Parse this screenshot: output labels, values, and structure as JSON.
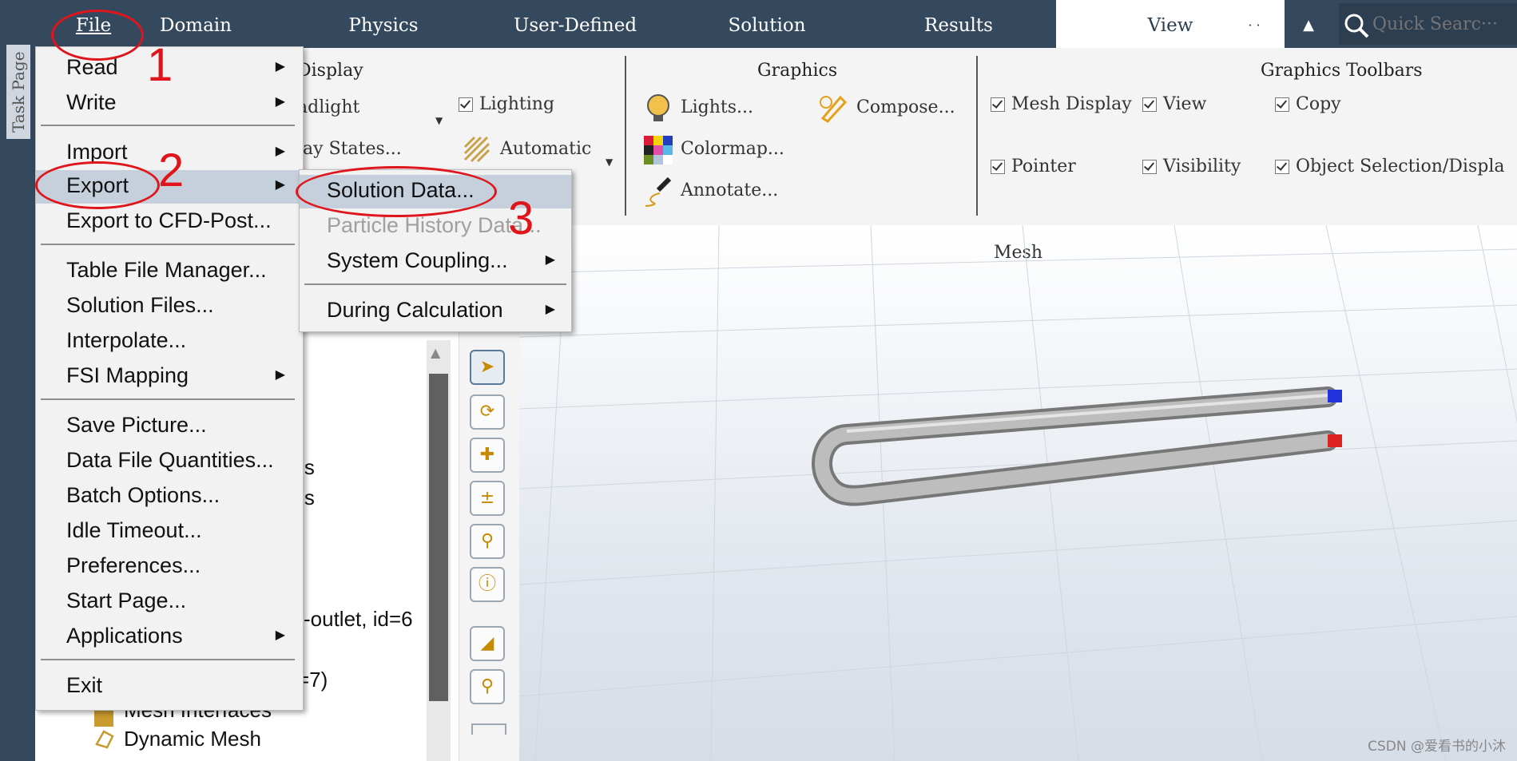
{
  "ribbon_tabs": [
    {
      "label": "File"
    },
    {
      "label": "Domain"
    },
    {
      "label": "Physics"
    },
    {
      "label": "User-Defined"
    },
    {
      "label": "Solution"
    },
    {
      "label": "Results"
    },
    {
      "label": "View"
    },
    {
      "label": "· ·"
    }
  ],
  "search": {
    "placeholder": "Quick Searc···"
  },
  "ribbon": {
    "display": {
      "heading": "Display",
      "headlight": "adlight",
      "display_states": "lay States...",
      "lighting": "Lighting",
      "automatic": "Automatic"
    },
    "graphics": {
      "heading": "Graphics",
      "lights": "Lights...",
      "compose": "Compose...",
      "colormap": "Colormap...",
      "annotate": "Annotate..."
    },
    "toolbars": {
      "heading": "Graphics Toolbars",
      "mesh_display": "Mesh Display",
      "view": "View",
      "copy": "Copy",
      "pointer": "Pointer",
      "visibility": "Visibility",
      "object_selection": "Object Selection/Displa"
    }
  },
  "task_page_label": "Task Page",
  "file_menu": {
    "items": [
      {
        "label": "Read"
      },
      {
        "label": "Write"
      },
      {
        "label": "Import"
      },
      {
        "label": "Export"
      },
      {
        "label": "Export to CFD-Post..."
      },
      {
        "label": "Table File Manager..."
      },
      {
        "label": "Solution Files..."
      },
      {
        "label": "Interpolate..."
      },
      {
        "label": "FSI Mapping"
      },
      {
        "label": "Save Picture..."
      },
      {
        "label": "Data File Quantities..."
      },
      {
        "label": "Batch Options..."
      },
      {
        "label": "Idle Timeout..."
      },
      {
        "label": "Preferences..."
      },
      {
        "label": "Start Page..."
      },
      {
        "label": "Applications"
      },
      {
        "label": "Exit"
      }
    ]
  },
  "export_submenu": {
    "items": [
      {
        "label": "Solution Data..."
      },
      {
        "label": "Particle History Data..."
      },
      {
        "label": "System Coupling..."
      },
      {
        "label": "During Calculation"
      }
    ]
  },
  "tree_fragments": {
    "t1": "ons",
    "t2": "ons",
    "t3": "-outlet, id=6",
    "t4": "=7)",
    "t5": "Mesh Interfaces",
    "t6": "Dynamic Mesh"
  },
  "viewport": {
    "title": "Mesh"
  },
  "annotations": {
    "n1": "1",
    "n2": "2",
    "n3": "3"
  },
  "watermark": "CSDN @爱看书的小沐",
  "colors": {
    "ribbon_dark": "#34495e",
    "highlight": "#c5d0dc",
    "annotation_red": "#e0151c"
  }
}
